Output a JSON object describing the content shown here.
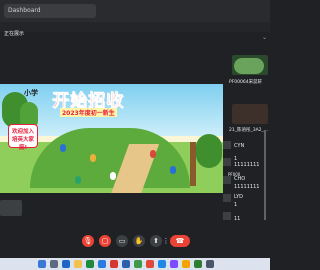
{
  "browser": {
    "tab_title": "Dashboard"
  },
  "banner": {
    "presenting_text": "正在展示"
  },
  "stage": {
    "brand": "小学",
    "title": "开始招收",
    "subtitle": "2023年度初一新生",
    "welcome_lines": [
      "欢迎加入",
      "培英大家庭!"
    ]
  },
  "participants": {
    "p1": "PF00064宋蕊轩",
    "p2": "21_陈语彤_3A2_...",
    "p3": "CYN",
    "p4_lines": [
      "1",
      "11111111"
    ],
    "pff": "PF000",
    "p5_name": "CHO",
    "p5_line": "11111111",
    "p6_name": "LYD",
    "p6_line": "1",
    "p7_line": "11"
  },
  "controls": {
    "mic": "mic-off-icon",
    "camera": "camera-off-icon",
    "captions": "captions-icon",
    "hand": "raise-hand-icon",
    "present": "present-icon",
    "more": "more-icon",
    "end": "end-call-icon"
  },
  "colors": {
    "end_call": "#ea4335",
    "title_red": "#e7223f",
    "background": "#202124"
  }
}
